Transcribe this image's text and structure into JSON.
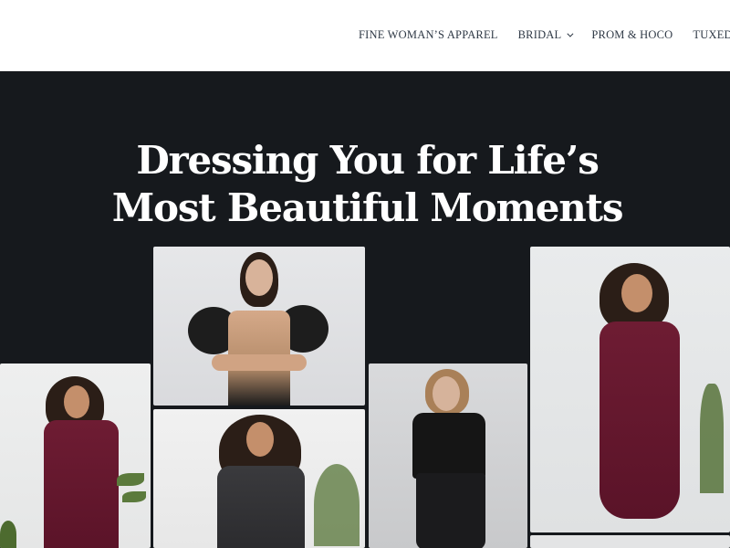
{
  "nav": {
    "items": [
      {
        "label": "FINE WOMAN’S APPAREL",
        "has_dropdown": false
      },
      {
        "label": "BRIDAL",
        "has_dropdown": true
      },
      {
        "label": "PROM & HOCO",
        "has_dropdown": false
      },
      {
        "label": "TUXEDOS & SUITS",
        "has_dropdown": false
      }
    ]
  },
  "hero": {
    "headline_line1": "Dressing You for Life’s",
    "headline_line2": "Most Beautiful Moments"
  },
  "colors": {
    "hero_background": "#16191d",
    "nav_text": "#2f3946",
    "headline_text": "#ffffff",
    "burgundy_dress": "#6e1c33"
  },
  "icons": {
    "dropdown": "chevron-down-icon"
  }
}
